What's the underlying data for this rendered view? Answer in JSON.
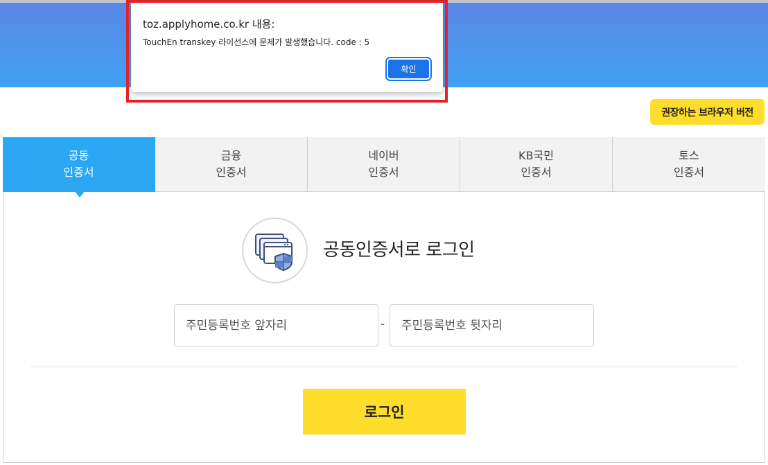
{
  "dialog": {
    "title": "toz.applyhome.co.kr 내용:",
    "message": "TouchEn transkey 라이선스에 문제가 발생했습니다. code : 5",
    "ok_label": "확인"
  },
  "header": {
    "recommended_browser_label": "권장하는 브라우저 버전"
  },
  "tabs": [
    {
      "line1": "공동",
      "line2": "인증서",
      "active": true
    },
    {
      "line1": "금융",
      "line2": "인증서",
      "active": false
    },
    {
      "line1": "네이버",
      "line2": "인증서",
      "active": false
    },
    {
      "line1": "KB국민",
      "line2": "인증서",
      "active": false
    },
    {
      "line1": "토스",
      "line2": "인증서",
      "active": false
    }
  ],
  "login": {
    "title": "공동인증서로 로그인",
    "rrn_front_placeholder": "주민등록번호 앞자리",
    "rrn_back_placeholder": "주민등록번호 뒷자리",
    "separator": "-",
    "button_label": "로그인"
  },
  "colors": {
    "banner_top": "#5c86e6",
    "banner_bottom": "#3fa2f3",
    "active_tab": "#2ba6f2",
    "accent_yellow": "#ffdd2b",
    "highlight_red": "#e0222d",
    "dialog_button": "#1a73e8"
  },
  "icons": {
    "certificate": "certificate-shield-icon"
  }
}
